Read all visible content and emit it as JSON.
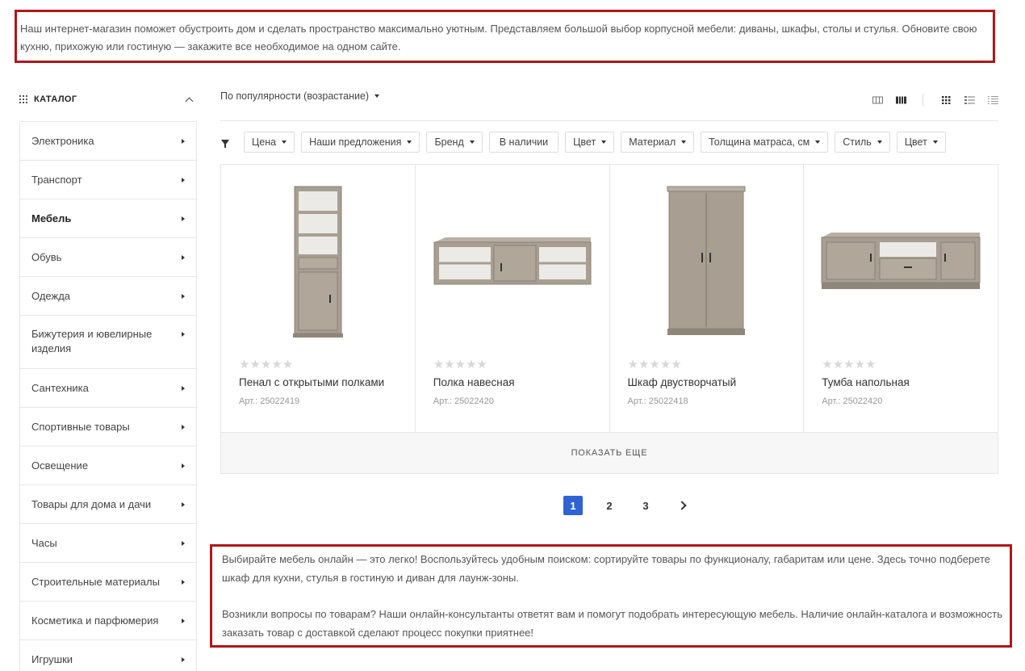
{
  "intro_text": "Наш интернет-магазин поможет обустроить дом и сделать пространство максимально уютным. Представляем большой выбор корпусной мебели: диваны, шкафы, столы и стулья. Обновите свою кухню, прихожую или гостиную — закажите все необходимое на одном сайте.",
  "sidebar": {
    "title": "КАТАЛОГ",
    "items": [
      {
        "label": "Электроника"
      },
      {
        "label": "Транспорт"
      },
      {
        "label": "Мебель"
      },
      {
        "label": "Обувь"
      },
      {
        "label": "Одежда"
      },
      {
        "label": "Бижутерия и ювелирные изделия"
      },
      {
        "label": "Сантехника"
      },
      {
        "label": "Спортивные товары"
      },
      {
        "label": "Освещение"
      },
      {
        "label": "Товары для дома и дачи"
      },
      {
        "label": "Часы"
      },
      {
        "label": "Строительные материалы"
      },
      {
        "label": "Косметика и парфюмерия"
      },
      {
        "label": "Игрушки"
      }
    ],
    "active_index": 2
  },
  "sort": {
    "label": "По популярности (возрастание)"
  },
  "filters": [
    "Цена",
    "Наши предложения",
    "Бренд",
    "В наличии",
    "Цвет",
    "Материал",
    "Толщина матраса, см",
    "Стиль",
    "Цвет"
  ],
  "products": [
    {
      "name": "Пенал с открытыми полками",
      "article": "Арт.: 25022419",
      "rating": 0,
      "image": "tall-shelf-cabinet"
    },
    {
      "name": "Полка навесная",
      "article": "Арт.: 25022420",
      "rating": 0,
      "image": "wall-shelf"
    },
    {
      "name": "Шкаф двустворчатый",
      "article": "Арт.: 25022418",
      "rating": 0,
      "image": "two-door-wardrobe"
    },
    {
      "name": "Тумба напольная",
      "article": "Арт.: 25022420",
      "rating": 0,
      "image": "tv-stand"
    }
  ],
  "show_more_label": "ПОКАЗАТЬ ЕЩЕ",
  "pagination": {
    "pages": [
      "1",
      "2",
      "3"
    ],
    "current": "1"
  },
  "bottom_text": {
    "p1": "Выбирайте мебель онлайн — это легко! Воспользуйтесь удобным поиском: сортируйте товары по функционалу, габаритам или цене. Здесь точно подберете шкаф для кухни, стулья в гостиную и диван для лаунж-зоны.",
    "p2": "Возникли вопросы по товарам? Наши онлайн-консультанты ответят вам и помогут подобрать интересующую мебель. Наличие онлайн-каталога и возможность заказать товар с доставкой сделают процесс покупки приятнее!"
  },
  "colors": {
    "accent": "#2f62d4",
    "highlight_border": "#b0161b",
    "wood": "#a89e92"
  }
}
